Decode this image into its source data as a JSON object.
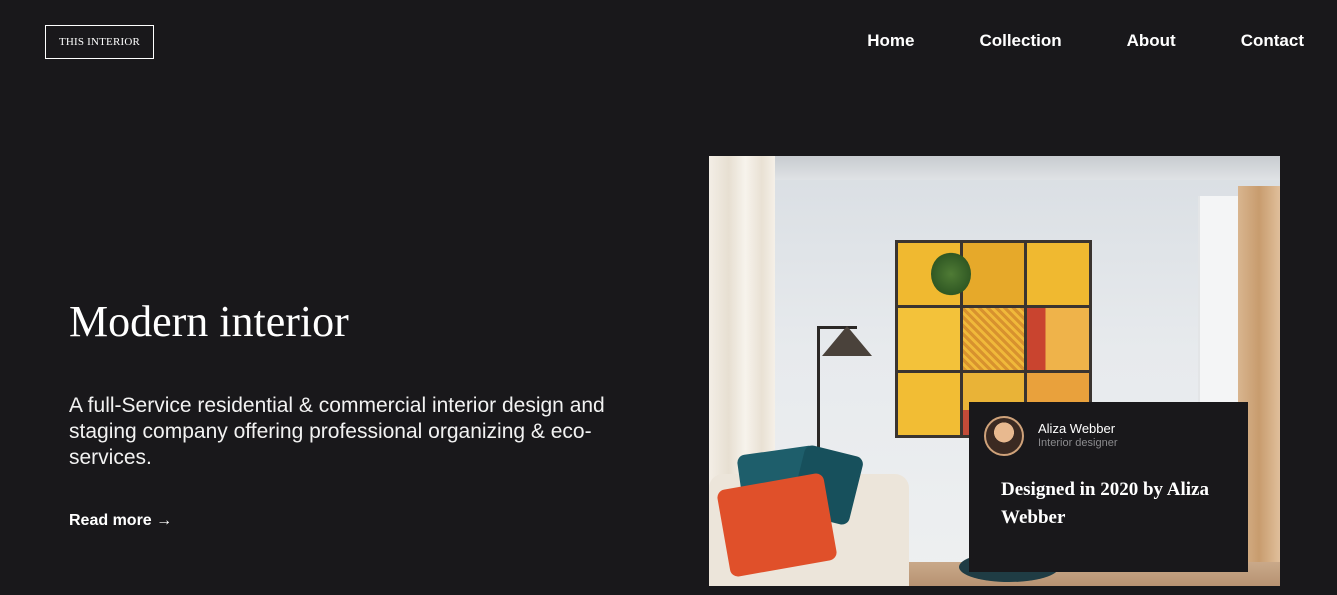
{
  "brand": {
    "logo_text": "THIS INTERIOR"
  },
  "nav": {
    "items": [
      {
        "label": "Home"
      },
      {
        "label": "Collection"
      },
      {
        "label": "About"
      },
      {
        "label": "Contact"
      }
    ]
  },
  "hero": {
    "title": "Modern interior",
    "description": "A full-Service residential & commercial interior design and staging company offering professional organizing & eco-services.",
    "cta_label": "Read more →"
  },
  "feature_card": {
    "designer_name": "Aliza Webber",
    "designer_role": "Interior designer",
    "headline": "Designed in 2020 by Aliza Webber"
  },
  "colors": {
    "background": "#19181b",
    "text": "#ffffff",
    "muted": "#8b8b8e"
  }
}
